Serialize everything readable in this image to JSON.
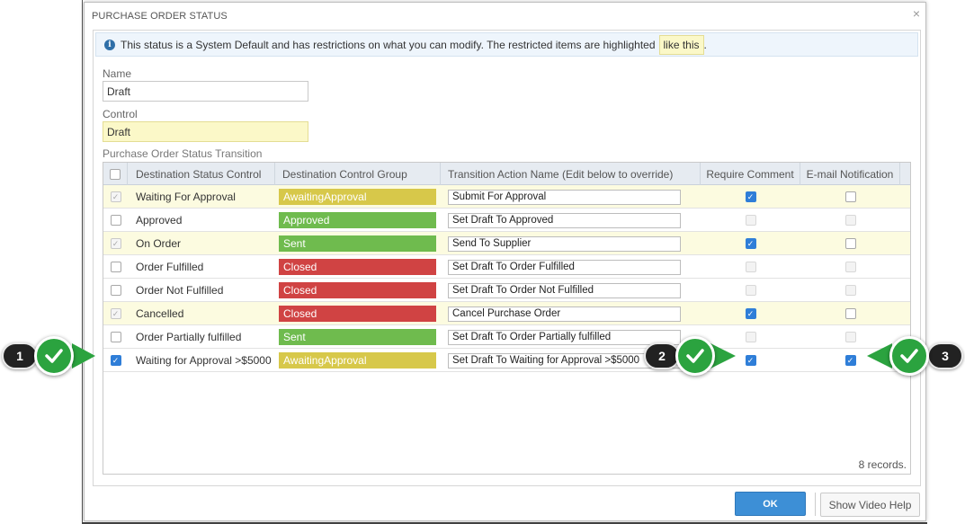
{
  "dialog": {
    "title": "PURCHASE ORDER STATUS",
    "close_glyph": "×"
  },
  "info": {
    "icon": "info-icon",
    "text": "This status is a System Default and has restrictions on what you can modify. The restricted items are highlighted",
    "highlight_example": "like this",
    "end": "."
  },
  "fields": {
    "name_label": "Name",
    "name_value": "Draft",
    "control_label": "Control",
    "control_value": "Draft"
  },
  "transition": {
    "section_label": "Purchase Order Status Transition",
    "columns": [
      "Destination Status Control",
      "Destination Control Group",
      "Transition Action Name (Edit below to override)",
      "Require Comment",
      "E-mail Notification"
    ],
    "rows": [
      {
        "status": "Waiting For Approval",
        "group": "AwaitingApproval",
        "group_color": "#d7c84a",
        "action": "Submit For Approval",
        "restricted": true,
        "selected": true,
        "require_comment": true,
        "require_enabled": true,
        "email": false,
        "email_enabled": true
      },
      {
        "status": "Approved",
        "group": "Approved",
        "group_color": "#6fbb4e",
        "action": "Set Draft To Approved",
        "restricted": false,
        "selected": false,
        "require_comment": false,
        "require_enabled": false,
        "email": false,
        "email_enabled": false
      },
      {
        "status": "On Order",
        "group": "Sent",
        "group_color": "#6fbb4e",
        "action": "Send To Supplier",
        "restricted": true,
        "selected": true,
        "require_comment": true,
        "require_enabled": true,
        "email": false,
        "email_enabled": true
      },
      {
        "status": "Order Fulfilled",
        "group": "Closed",
        "group_color": "#d04343",
        "action": "Set Draft To Order Fulfilled",
        "restricted": false,
        "selected": false,
        "require_comment": false,
        "require_enabled": false,
        "email": false,
        "email_enabled": false
      },
      {
        "status": "Order Not Fulfilled",
        "group": "Closed",
        "group_color": "#d04343",
        "action": "Set Draft To Order Not Fulfilled",
        "restricted": false,
        "selected": false,
        "require_comment": false,
        "require_enabled": false,
        "email": false,
        "email_enabled": false
      },
      {
        "status": "Cancelled",
        "group": "Closed",
        "group_color": "#d04343",
        "action": "Cancel Purchase Order",
        "restricted": true,
        "selected": true,
        "require_comment": true,
        "require_enabled": true,
        "email": false,
        "email_enabled": true
      },
      {
        "status": "Order Partially fulfilled",
        "group": "Sent",
        "group_color": "#6fbb4e",
        "action": "Set Draft To Order Partially fulfilled",
        "restricted": false,
        "selected": false,
        "require_comment": false,
        "require_enabled": false,
        "email": false,
        "email_enabled": false
      },
      {
        "status": "Waiting for Approval >$5000",
        "group": "AwaitingApproval",
        "group_color": "#d7c84a",
        "action": "Set Draft To Waiting for Approval >$5000",
        "restricted": false,
        "selected": true,
        "require_comment": true,
        "require_enabled": true,
        "email": true,
        "email_enabled": true,
        "user_checked": true
      }
    ],
    "records": "8 records."
  },
  "buttons": {
    "ok": "OK",
    "help": "Show Video Help"
  },
  "callouts": [
    {
      "number": "1"
    },
    {
      "number": "2"
    },
    {
      "number": "3"
    }
  ],
  "colors": {
    "accent": "#3d8fd6",
    "restricted_bg": "#fcfbe0",
    "callout_green": "#2ba33f"
  }
}
